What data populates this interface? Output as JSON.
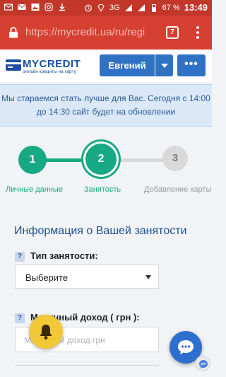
{
  "status_bar": {
    "battery_percent": "67 %",
    "network": "3G",
    "time": "13:49"
  },
  "browser": {
    "url_host": "https://mycredit.ua",
    "url_path": "/ru/regi",
    "tab_count": "7"
  },
  "header": {
    "logo_title": "MYCREDIT",
    "logo_subtitle": "онлайн кредиты на карту",
    "user_name": "Евгений",
    "more_label": "•••"
  },
  "notice": {
    "line1": "Мы стараемся стать лучше для Вас. Сегодня с 14:00",
    "line2": "до 14:30 сайт будет на обновлении"
  },
  "stepper": {
    "steps": [
      {
        "number": "1",
        "label": "Личные данные",
        "state": "done"
      },
      {
        "number": "2",
        "label": "Занятость",
        "state": "active"
      },
      {
        "number": "3",
        "label": "Добавление карты",
        "state": "todo"
      }
    ]
  },
  "form": {
    "section_title": "Информация о Вашей занятости",
    "employment_type": {
      "help": "?",
      "label": "Тип занятости:",
      "value": "Выберите"
    },
    "monthly_income": {
      "help": "?",
      "label": "Месячный доход ( грн ):",
      "placeholder": "Месячный доход грн"
    }
  },
  "colors": {
    "status_bar": "#c2372a",
    "url_bar": "#d64032",
    "brand_blue": "#2f72c4",
    "step_green": "#17a983",
    "notice_bg": "#dbe8f8",
    "bell_yellow": "#f2c738"
  }
}
